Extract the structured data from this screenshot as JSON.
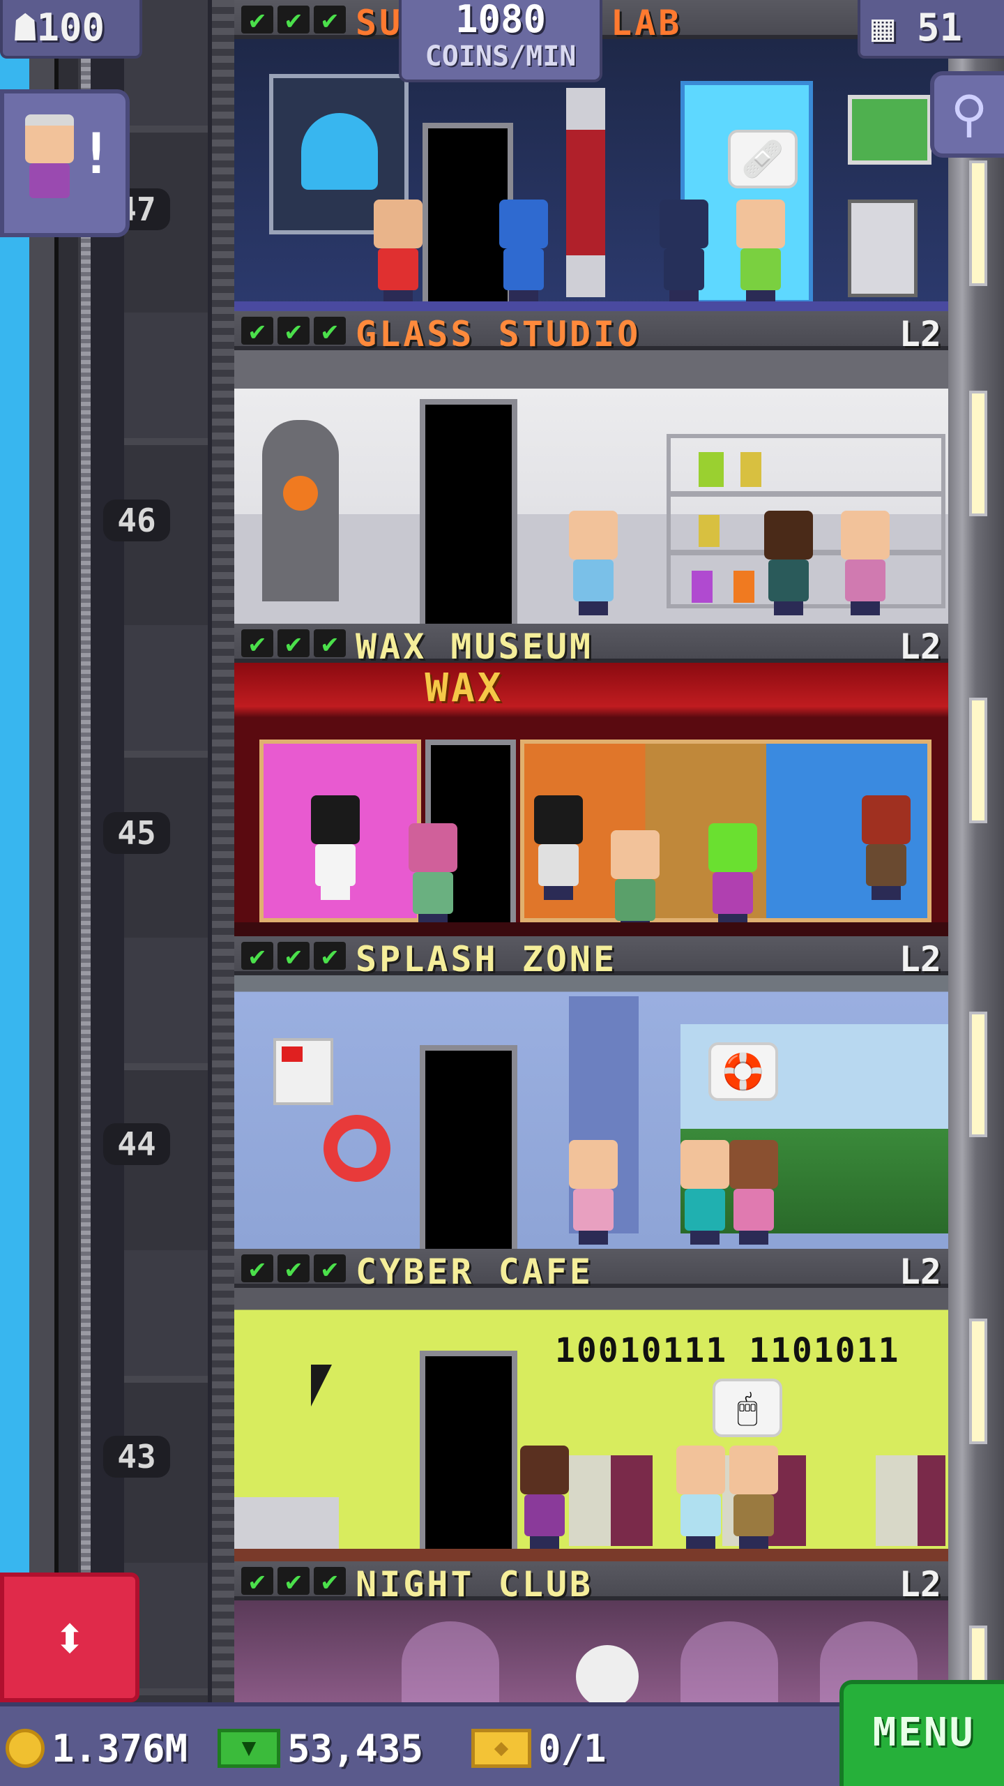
{
  "top": {
    "population": "100",
    "coins_per_min_value": "1080",
    "coins_per_min_label": "COINS/MIN",
    "floors_count": "51"
  },
  "icons": {
    "population": "person-icon",
    "floors": "building-icon",
    "search": "magnifier-icon",
    "elevator": "up-down-arrows-icon",
    "coins": "coin-icon",
    "bux": "bux-icon",
    "tickets": "golden-ticket-icon"
  },
  "shaft_numbers": [
    "47",
    "46",
    "45",
    "44",
    "43"
  ],
  "floors": [
    {
      "name": "SU",
      "name_tail": "LAB",
      "level": "",
      "checks": [
        "✔",
        "✔",
        "✔"
      ],
      "bubble": "🩹",
      "theme": "#1e2848"
    },
    {
      "name": "GLASS STUDIO",
      "level": "L2",
      "checks": [
        "✔",
        "✔",
        "✔"
      ],
      "bubble": "",
      "theme": "#e4e4e6"
    },
    {
      "name": "WAX MUSEUM",
      "level": "L2",
      "checks": [
        "✔",
        "✔",
        "✔"
      ],
      "bubble": "",
      "theme": "#8a1010",
      "sign": "WAX"
    },
    {
      "name": "SPLASH ZONE",
      "level": "L2",
      "checks": [
        "✔",
        "✔",
        "✔"
      ],
      "bubble": "🛟",
      "theme": "#8fa6d6"
    },
    {
      "name": "CYBER CAFE",
      "level": "L2",
      "checks": [
        "✔",
        "✔",
        "✔"
      ],
      "bubble": "🖱",
      "theme": "#d8ec5e",
      "binary": "10010111  1101011"
    },
    {
      "name": "NIGHT CLUB",
      "level": "L2",
      "checks": [
        "✔",
        "✔",
        "✔"
      ],
      "bubble": "",
      "theme": "#7a4a72"
    }
  ],
  "elevator_button": {
    "label": "⬍"
  },
  "bottom": {
    "coins": "1.376M",
    "bux": "53,435",
    "tickets": "0/1",
    "menu": "MENU"
  },
  "colors": {
    "check": "#4be04b",
    "floor_name": "#f5ee9a",
    "menu": "#26b03a",
    "elevator": "#e02a4a"
  }
}
